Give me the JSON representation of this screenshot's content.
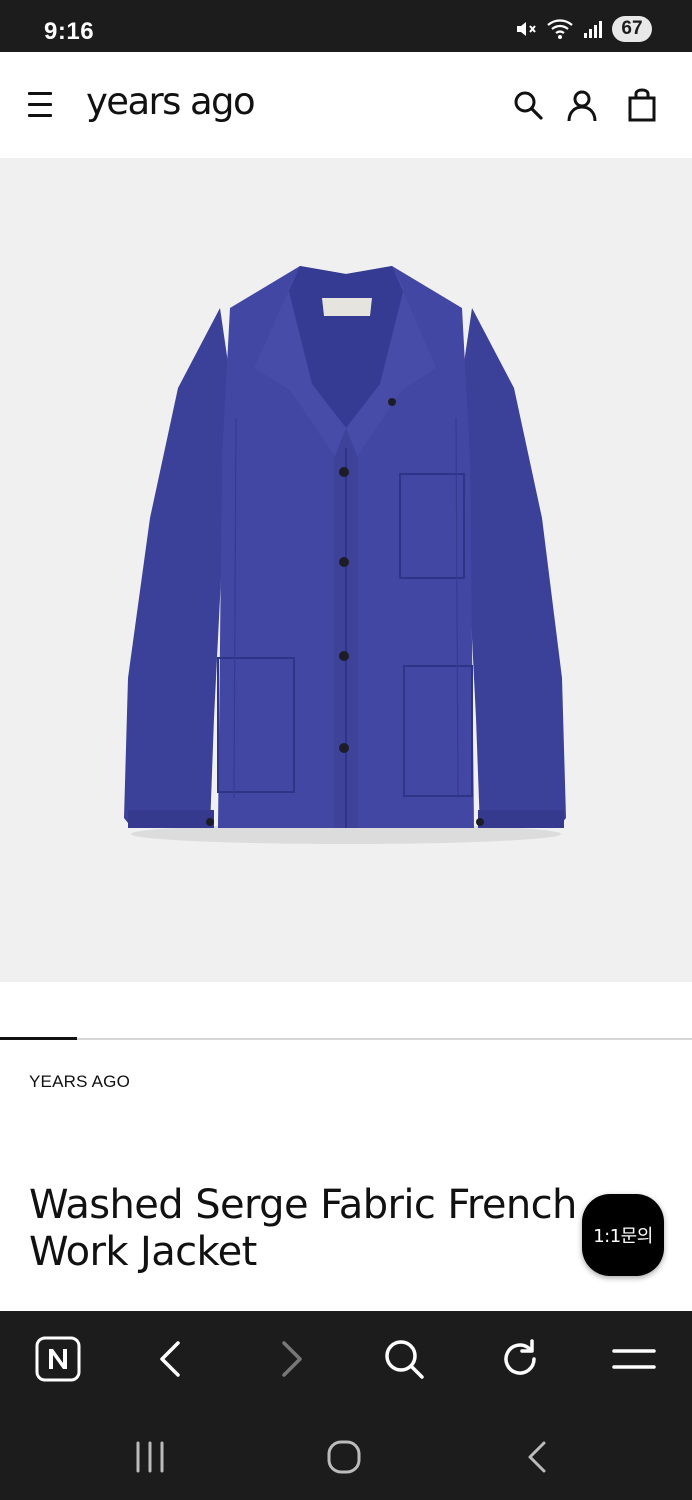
{
  "status_bar": {
    "time": "9:16",
    "battery": "67",
    "icons": [
      "mute-icon",
      "wifi-icon",
      "signal-icon",
      "battery-icon"
    ]
  },
  "header": {
    "logo": "years ago",
    "icons": [
      "menu-icon",
      "search-icon",
      "account-icon",
      "shopping-bag-icon"
    ]
  },
  "product": {
    "image": {
      "description_icon": "jacket-image",
      "color": "#3f44a0"
    },
    "gallery_position": 1,
    "brand": "YEARS AGO",
    "title": "Washed Serge Fabric French Work Jacket",
    "chat_label": "1:1문의"
  },
  "browser_toolbar": {
    "icons": [
      "naver-icon",
      "back-icon",
      "forward-icon",
      "search-icon",
      "refresh-icon",
      "menu-icon"
    ]
  },
  "system_nav": {
    "icons": [
      "recents-icon",
      "home-icon",
      "back-icon"
    ]
  },
  "colors": {
    "status_bar_bg": "#1c1c1c",
    "image_bg": "#f0f0f0",
    "jacket": "#3f44a0",
    "accent_black": "#000000"
  }
}
